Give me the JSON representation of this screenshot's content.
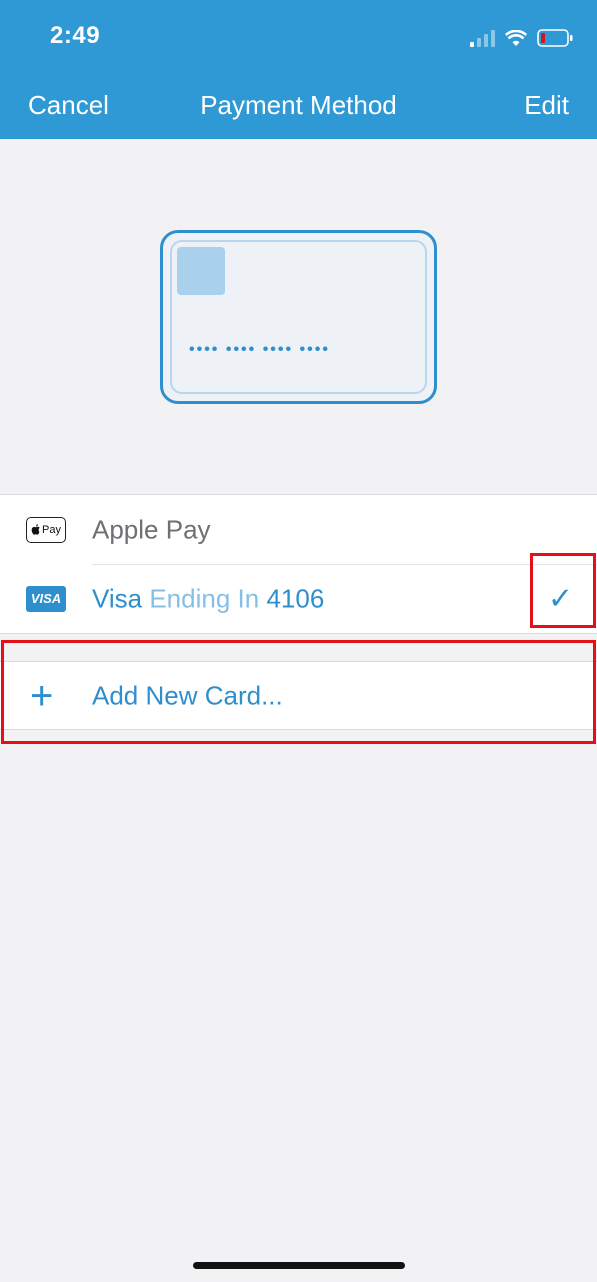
{
  "status_bar": {
    "time": "2:49"
  },
  "nav": {
    "cancel_label": "Cancel",
    "title": "Payment Method",
    "edit_label": "Edit"
  },
  "card_illustration": {
    "masked_number": "•••• •••• •••• ••••"
  },
  "payment_methods": [
    {
      "badge": "Pay",
      "label": "Apple Pay",
      "selected": false
    },
    {
      "badge": "VISA",
      "brand": "Visa",
      "middle": "Ending In",
      "last4": "4106",
      "selected": true
    }
  ],
  "selected_indicator": "✓",
  "add_card": {
    "icon": "+",
    "label": "Add New Card..."
  },
  "colors": {
    "accent": "#2e99d4",
    "highlight": "#e3101a"
  }
}
